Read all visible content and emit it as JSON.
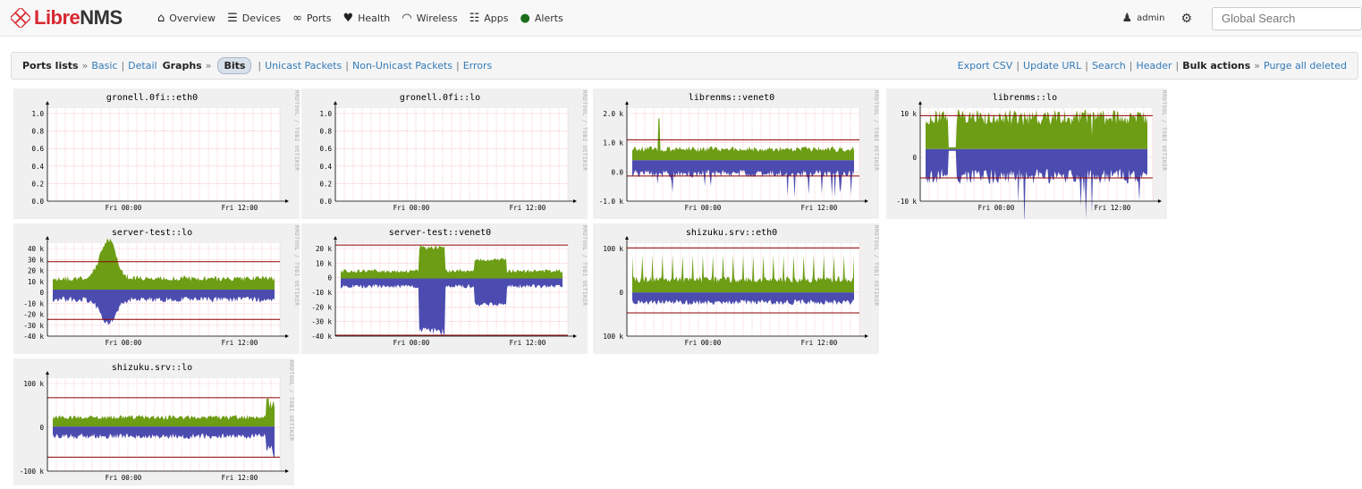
{
  "brand": {
    "name_part1": "Libre",
    "name_part2": "NMS"
  },
  "nav": [
    {
      "icon": "home-icon",
      "glyph": "⌂",
      "label": "Overview"
    },
    {
      "icon": "server-icon",
      "glyph": "☰",
      "label": "Devices"
    },
    {
      "icon": "link-icon",
      "glyph": "∞",
      "label": "Ports"
    },
    {
      "icon": "heartbeat-icon",
      "glyph": "♥",
      "label": "Health"
    },
    {
      "icon": "wifi-icon",
      "glyph": "◠",
      "label": "Wireless"
    },
    {
      "icon": "tasks-icon",
      "glyph": "☷",
      "label": "Apps"
    },
    {
      "icon": "alert-icon",
      "glyph": "●",
      "label": "Alerts"
    }
  ],
  "user": {
    "name": "admin"
  },
  "search": {
    "placeholder": "Global Search"
  },
  "toolbar": {
    "ports_lists": "Ports lists",
    "basic": "Basic",
    "detail": "Detail",
    "graphs": "Graphs",
    "bits": "Bits",
    "unicast": "Unicast Packets",
    "nonunicast": "Non-Unicast Packets",
    "errors": "Errors",
    "export_csv": "Export CSV",
    "update_url": "Update URL",
    "search": "Search",
    "header": "Header",
    "bulk_actions": "Bulk actions",
    "purge": "Purge all deleted"
  },
  "rrd_label": "RRDTOOL / TOBI OETIKER",
  "graphs": [
    {
      "title": "gronell.0fi::eth0",
      "type": "empty",
      "yticks": [
        "1.0",
        "0.8",
        "0.6",
        "0.4",
        "0.2",
        "0.0"
      ],
      "xticks": [
        "Fri 00:00",
        "Fri 12:00"
      ]
    },
    {
      "title": "gronell.0fi::lo",
      "type": "empty",
      "yticks": [
        "1.0",
        "0.8",
        "0.6",
        "0.4",
        "0.2",
        "0.0"
      ],
      "xticks": [
        "Fri 00:00",
        "Fri 12:00"
      ]
    },
    {
      "title": "librenms::venet0",
      "type": "traffic",
      "yticks": [
        "2.0 k",
        "1.0 k",
        "0.0",
        "-1.0 k"
      ],
      "xticks": [
        "Fri 00:00",
        "Fri 12:00"
      ]
    },
    {
      "title": "librenms::lo",
      "type": "traffic",
      "yticks": [
        "10 k",
        "0",
        "-10 k"
      ],
      "xticks": [
        "Fri 00:00",
        "Fri 12:00"
      ]
    },
    {
      "title": "server-test::lo",
      "type": "traffic",
      "yticks": [
        "40 k",
        "30 k",
        "20 k",
        "10 k",
        "0",
        "-10 k",
        "-20 k",
        "-30 k",
        "-40 k"
      ],
      "xticks": [
        "Fri 00:00",
        "Fri 12:00"
      ]
    },
    {
      "title": "server-test::venet0",
      "type": "traffic",
      "yticks": [
        "20 k",
        "10 k",
        "0",
        "-10 k",
        "-20 k",
        "-30 k",
        "-40 k"
      ],
      "xticks": [
        "Fri 00:00",
        "Fri 12:00"
      ]
    },
    {
      "title": "shizuku.srv::eth0",
      "type": "traffic",
      "yticks": [
        "100 k",
        "0",
        "100 k"
      ],
      "xticks": [
        "Fri 00:00",
        "Fri 12:00"
      ]
    },
    {
      "title": "shizuku.srv::lo",
      "type": "traffic",
      "yticks": [
        "100 k",
        "0",
        "-100 k"
      ],
      "xticks": [
        "Fri 00:00",
        "Fri 12:00"
      ]
    }
  ],
  "colors": {
    "in": "#6c9d14",
    "out": "#4c4cb0",
    "pct": "#8b0000",
    "grid": "#f3a3a3",
    "bg": "#f0f0f0"
  }
}
